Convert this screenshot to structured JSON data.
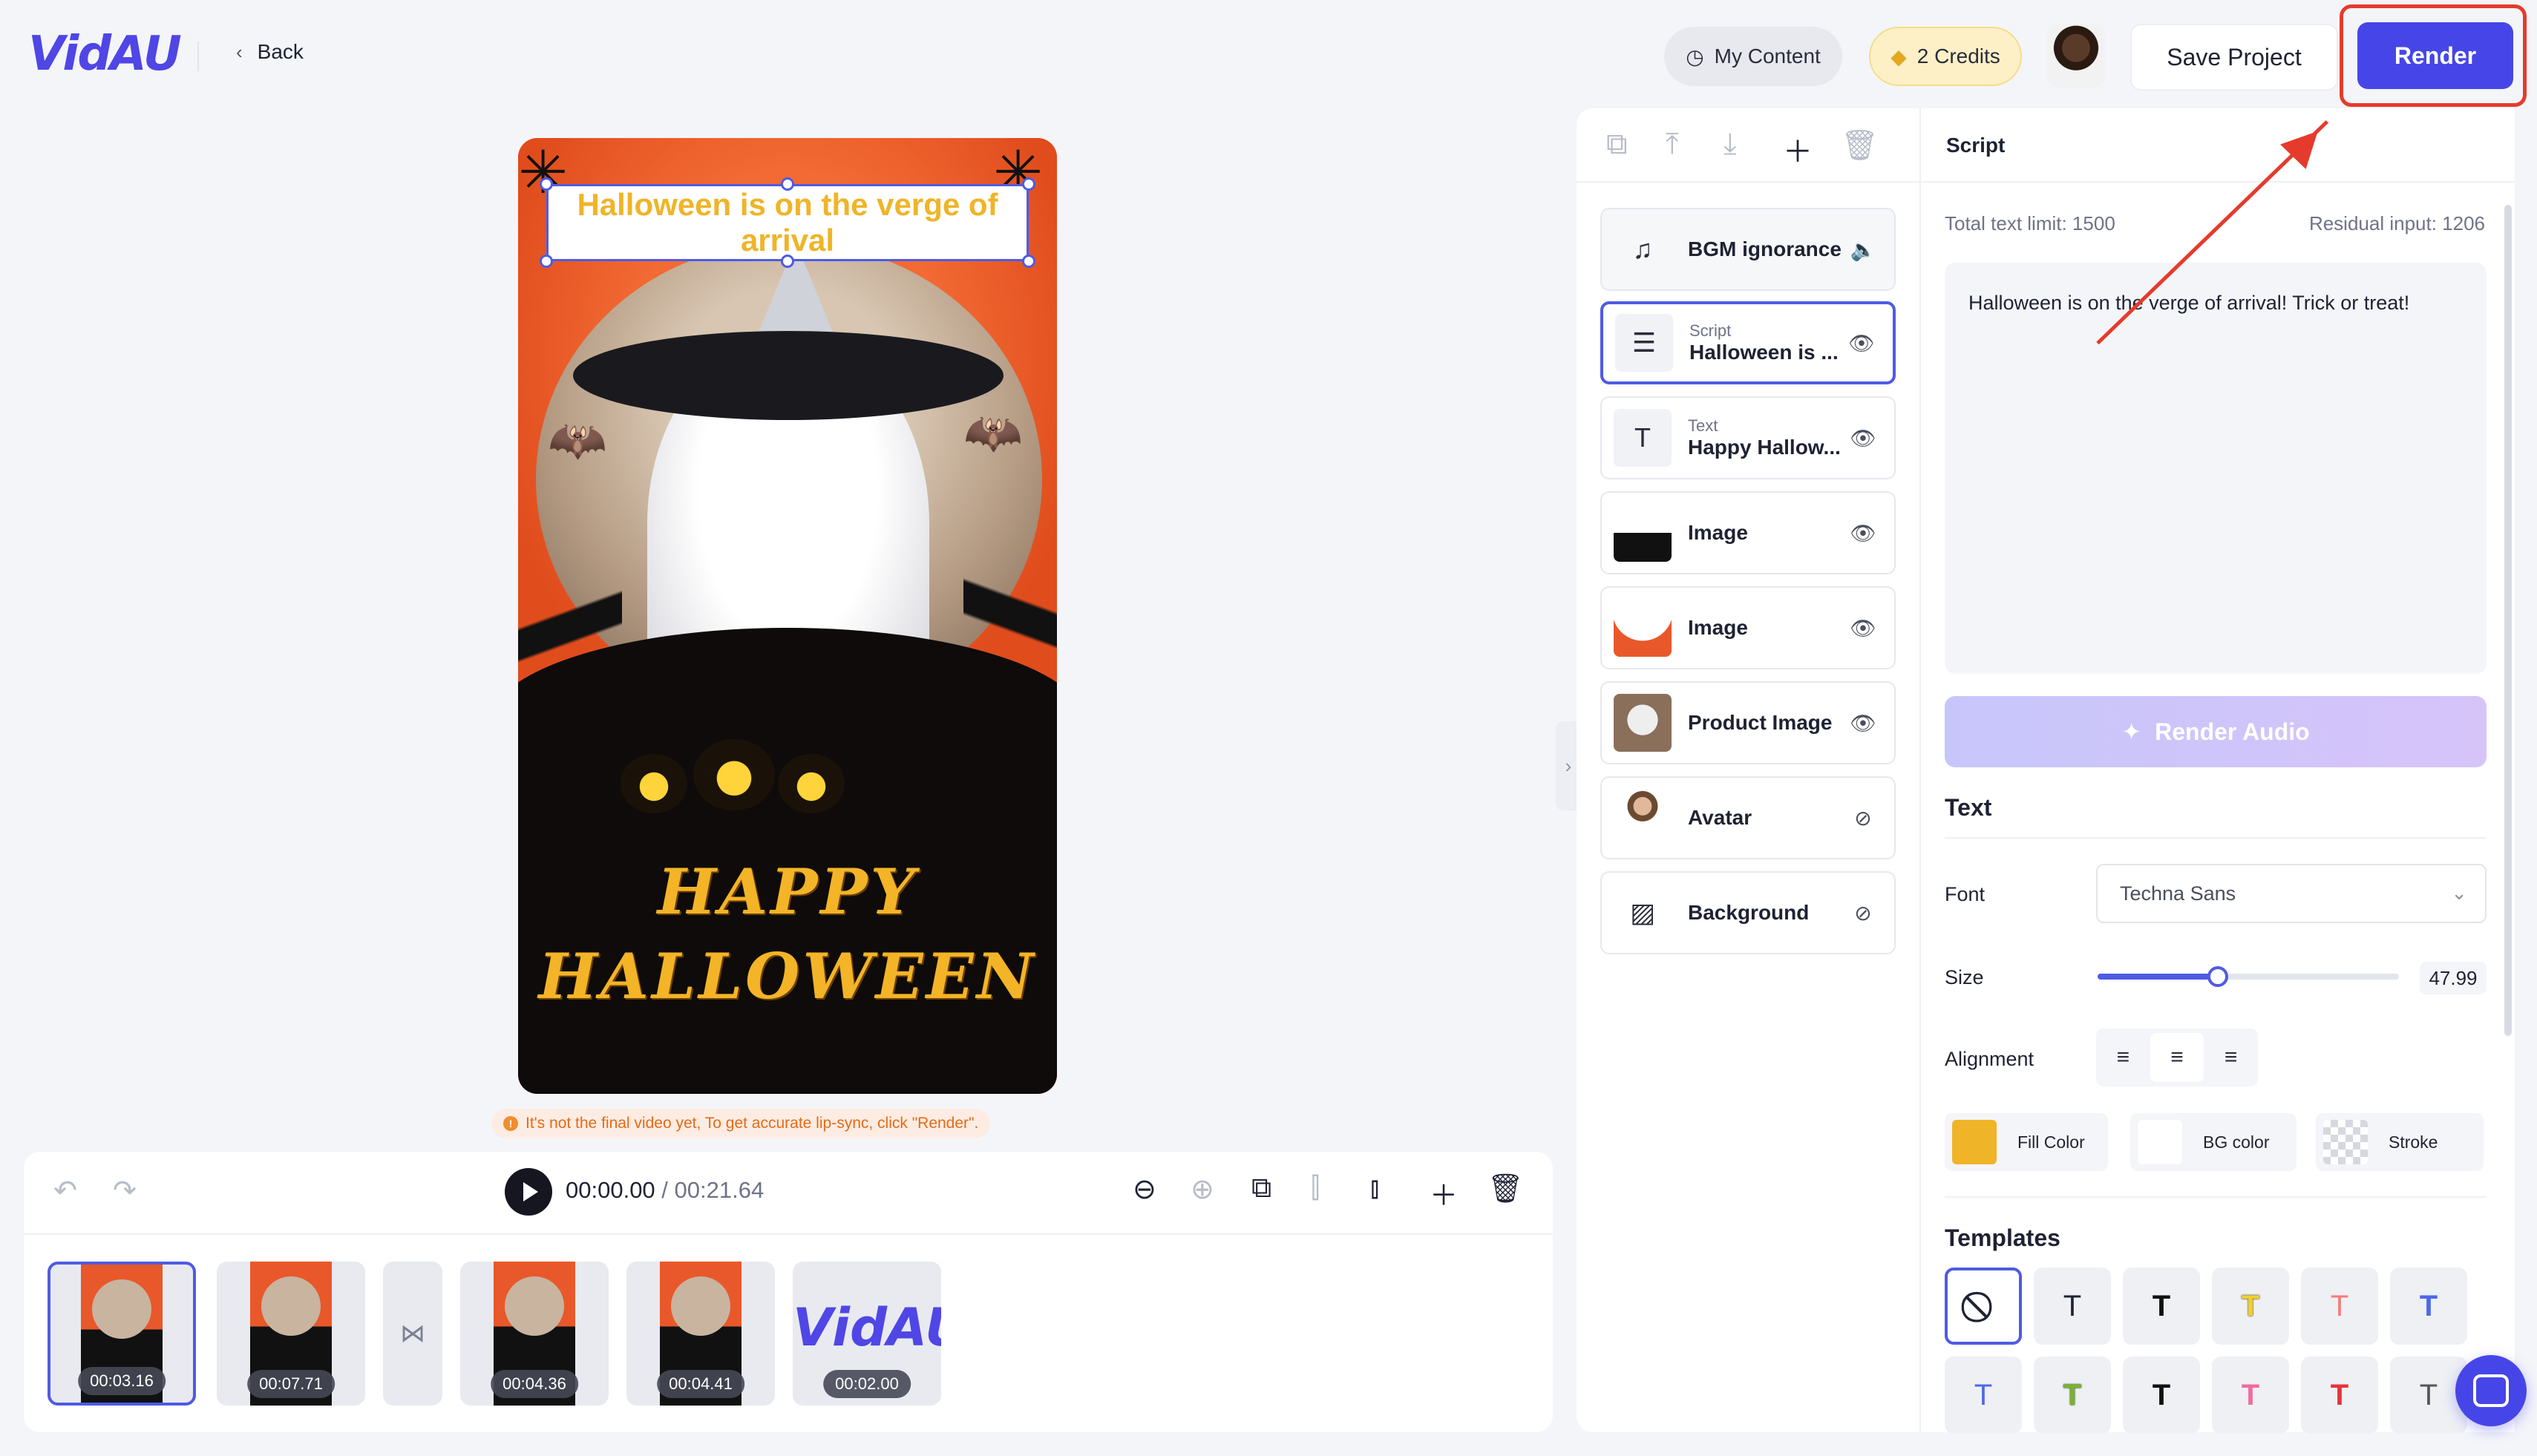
{
  "app": {
    "logo": "VidAU",
    "back_label": "Back"
  },
  "header": {
    "my_content": "My Content",
    "credits": "2 Credits",
    "save_project": "Save Project",
    "render": "Render"
  },
  "preview": {
    "title_text": "Halloween is on the verge of arrival",
    "happy_line1": "HAPPY",
    "happy_line2": "HALLOWEEN"
  },
  "notice": "It's not the final video yet, To get accurate lip-sync, click \"Render\".",
  "timeline": {
    "current_time": "00:00.00",
    "total_time": "/ 00:21.64",
    "clips": [
      {
        "duration": "00:03.16",
        "active": true
      },
      {
        "duration": "00:07.71",
        "active": false
      },
      {
        "duration": "00:04.36",
        "active": false
      },
      {
        "duration": "00:04.41",
        "active": false
      },
      {
        "duration": "00:02.00",
        "active": false,
        "logo": "VidAU"
      }
    ]
  },
  "layers": [
    {
      "sub": "",
      "main": "BGM ignorance",
      "icon": "music-note-icon",
      "right_icon": "volume-icon"
    },
    {
      "sub": "Script",
      "main": "Halloween is ...",
      "icon": "script-icon",
      "right_icon": "eye-icon",
      "active": true
    },
    {
      "sub": "Text",
      "main": "Happy Hallow...",
      "icon": "text-t-icon",
      "right_icon": "eye-icon"
    },
    {
      "sub": "",
      "main": "Image",
      "icon": "image-thumb",
      "right_icon": "eye-icon"
    },
    {
      "sub": "",
      "main": "Image",
      "icon": "image-thumb",
      "right_icon": "eye-icon"
    },
    {
      "sub": "",
      "main": "Product Image",
      "icon": "product-thumb",
      "right_icon": "eye-icon"
    },
    {
      "sub": "",
      "main": "Avatar",
      "icon": "avatar-thumb",
      "right_icon": "eye-off-icon"
    },
    {
      "sub": "",
      "main": "Background",
      "icon": "background-icon",
      "right_icon": "eye-off-icon"
    }
  ],
  "settings": {
    "tab_title": "Script",
    "total_limit": "Total text limit: 1500",
    "residual": "Residual input: 1206",
    "script_text": "Halloween is on the verge of arrival! Trick or treat!",
    "render_audio": "Render Audio",
    "text_section": "Text",
    "font_label": "Font",
    "font_value": "Techna Sans",
    "size_label": "Size",
    "size_value": "47.99",
    "size_fraction": 0.4,
    "alignment_label": "Alignment",
    "fill_color": "Fill Color",
    "bg_color": "BG color",
    "stroke": "Stroke",
    "templates_title": "Templates"
  },
  "colors": {
    "accent": "#4646e8",
    "highlight": "#e53b2c",
    "gold": "#f0b428"
  }
}
